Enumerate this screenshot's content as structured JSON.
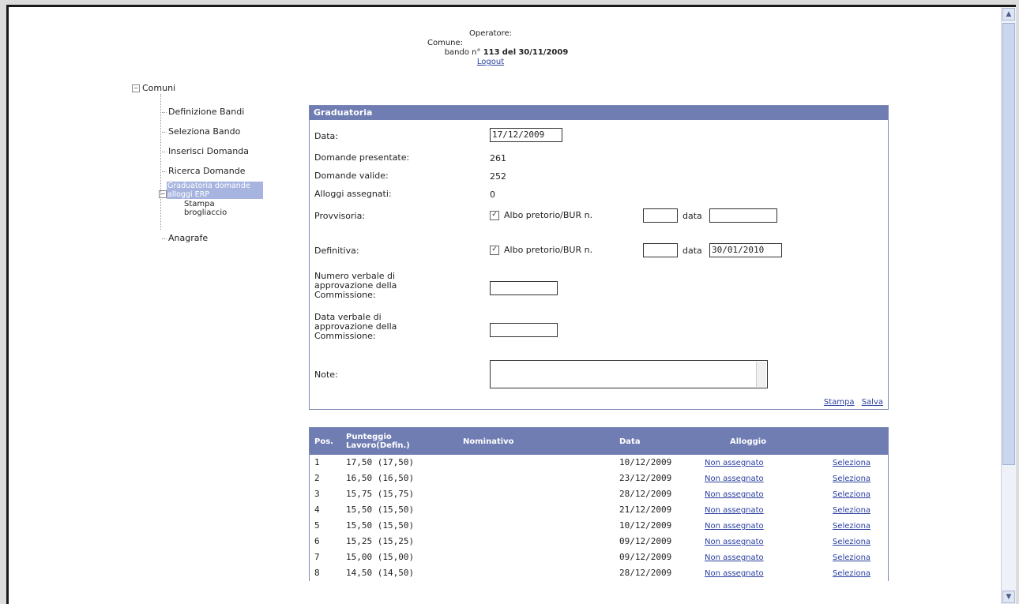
{
  "header": {
    "operatore_label": "Operatore:",
    "comune_label": "Comune:",
    "bando_text": "bando n°",
    "bando_num": "113",
    "bando_del": "del",
    "bando_date": "30/11/2009",
    "logout": "Logout"
  },
  "tree": {
    "root": "Comuni",
    "items": [
      "Definizione Bandi",
      "Seleziona Bando",
      "Inserisci Domanda",
      "Ricerca Domande"
    ],
    "selected": "Graduatoria domande alloggi ERP",
    "sub_item": "Stampa brogliaccio",
    "last_item": "Anagrafe"
  },
  "panel": {
    "title": "Graduatoria",
    "data_label": "Data:",
    "data_value": "17/12/2009",
    "presentate_label": "Domande presentate:",
    "presentate_value": "261",
    "valide_label": "Domande valide:",
    "valide_value": "252",
    "alloggi_label": "Alloggi assegnati:",
    "alloggi_value": "0",
    "provvisoria_label": "Provvisoria:",
    "definitiva_label": "Definitiva:",
    "albo_label": "Albo pretorio/BUR n.",
    "data_small": "data",
    "definitiva_data": "30/01/2010",
    "verbale_num_label": "Numero verbale di approvazione della Commissione:",
    "verbale_data_label": "Data verbale di approvazione della Commissione:",
    "note_label": "Note:",
    "stampa": "Stampa",
    "salva": "Salva"
  },
  "table": {
    "headers": [
      "Pos.",
      "Punteggio Lavoro(Defin.)",
      "Nominativo",
      "Data",
      "Alloggio"
    ],
    "rows": [
      {
        "pos": "1",
        "punteggio": "17,50 (17,50)",
        "data": "10/12/2009",
        "alloggio": "Non assegnato",
        "azione": "Seleziona"
      },
      {
        "pos": "2",
        "punteggio": "16,50 (16,50)",
        "data": "23/12/2009",
        "alloggio": "Non assegnato",
        "azione": "Seleziona"
      },
      {
        "pos": "3",
        "punteggio": "15,75 (15,75)",
        "data": "28/12/2009",
        "alloggio": "Non assegnato",
        "azione": "Seleziona"
      },
      {
        "pos": "4",
        "punteggio": "15,50 (15,50)",
        "data": "21/12/2009",
        "alloggio": "Non assegnato",
        "azione": "Seleziona"
      },
      {
        "pos": "5",
        "punteggio": "15,50 (15,50)",
        "data": "10/12/2009",
        "alloggio": "Non assegnato",
        "azione": "Seleziona"
      },
      {
        "pos": "6",
        "punteggio": "15,25 (15,25)",
        "data": "09/12/2009",
        "alloggio": "Non assegnato",
        "azione": "Seleziona"
      },
      {
        "pos": "7",
        "punteggio": "15,00 (15,00)",
        "data": "09/12/2009",
        "alloggio": "Non assegnato",
        "azione": "Seleziona"
      },
      {
        "pos": "8",
        "punteggio": "14,50 (14,50)",
        "data": "28/12/2009",
        "alloggio": "Non assegnato",
        "azione": "Seleziona"
      }
    ]
  }
}
